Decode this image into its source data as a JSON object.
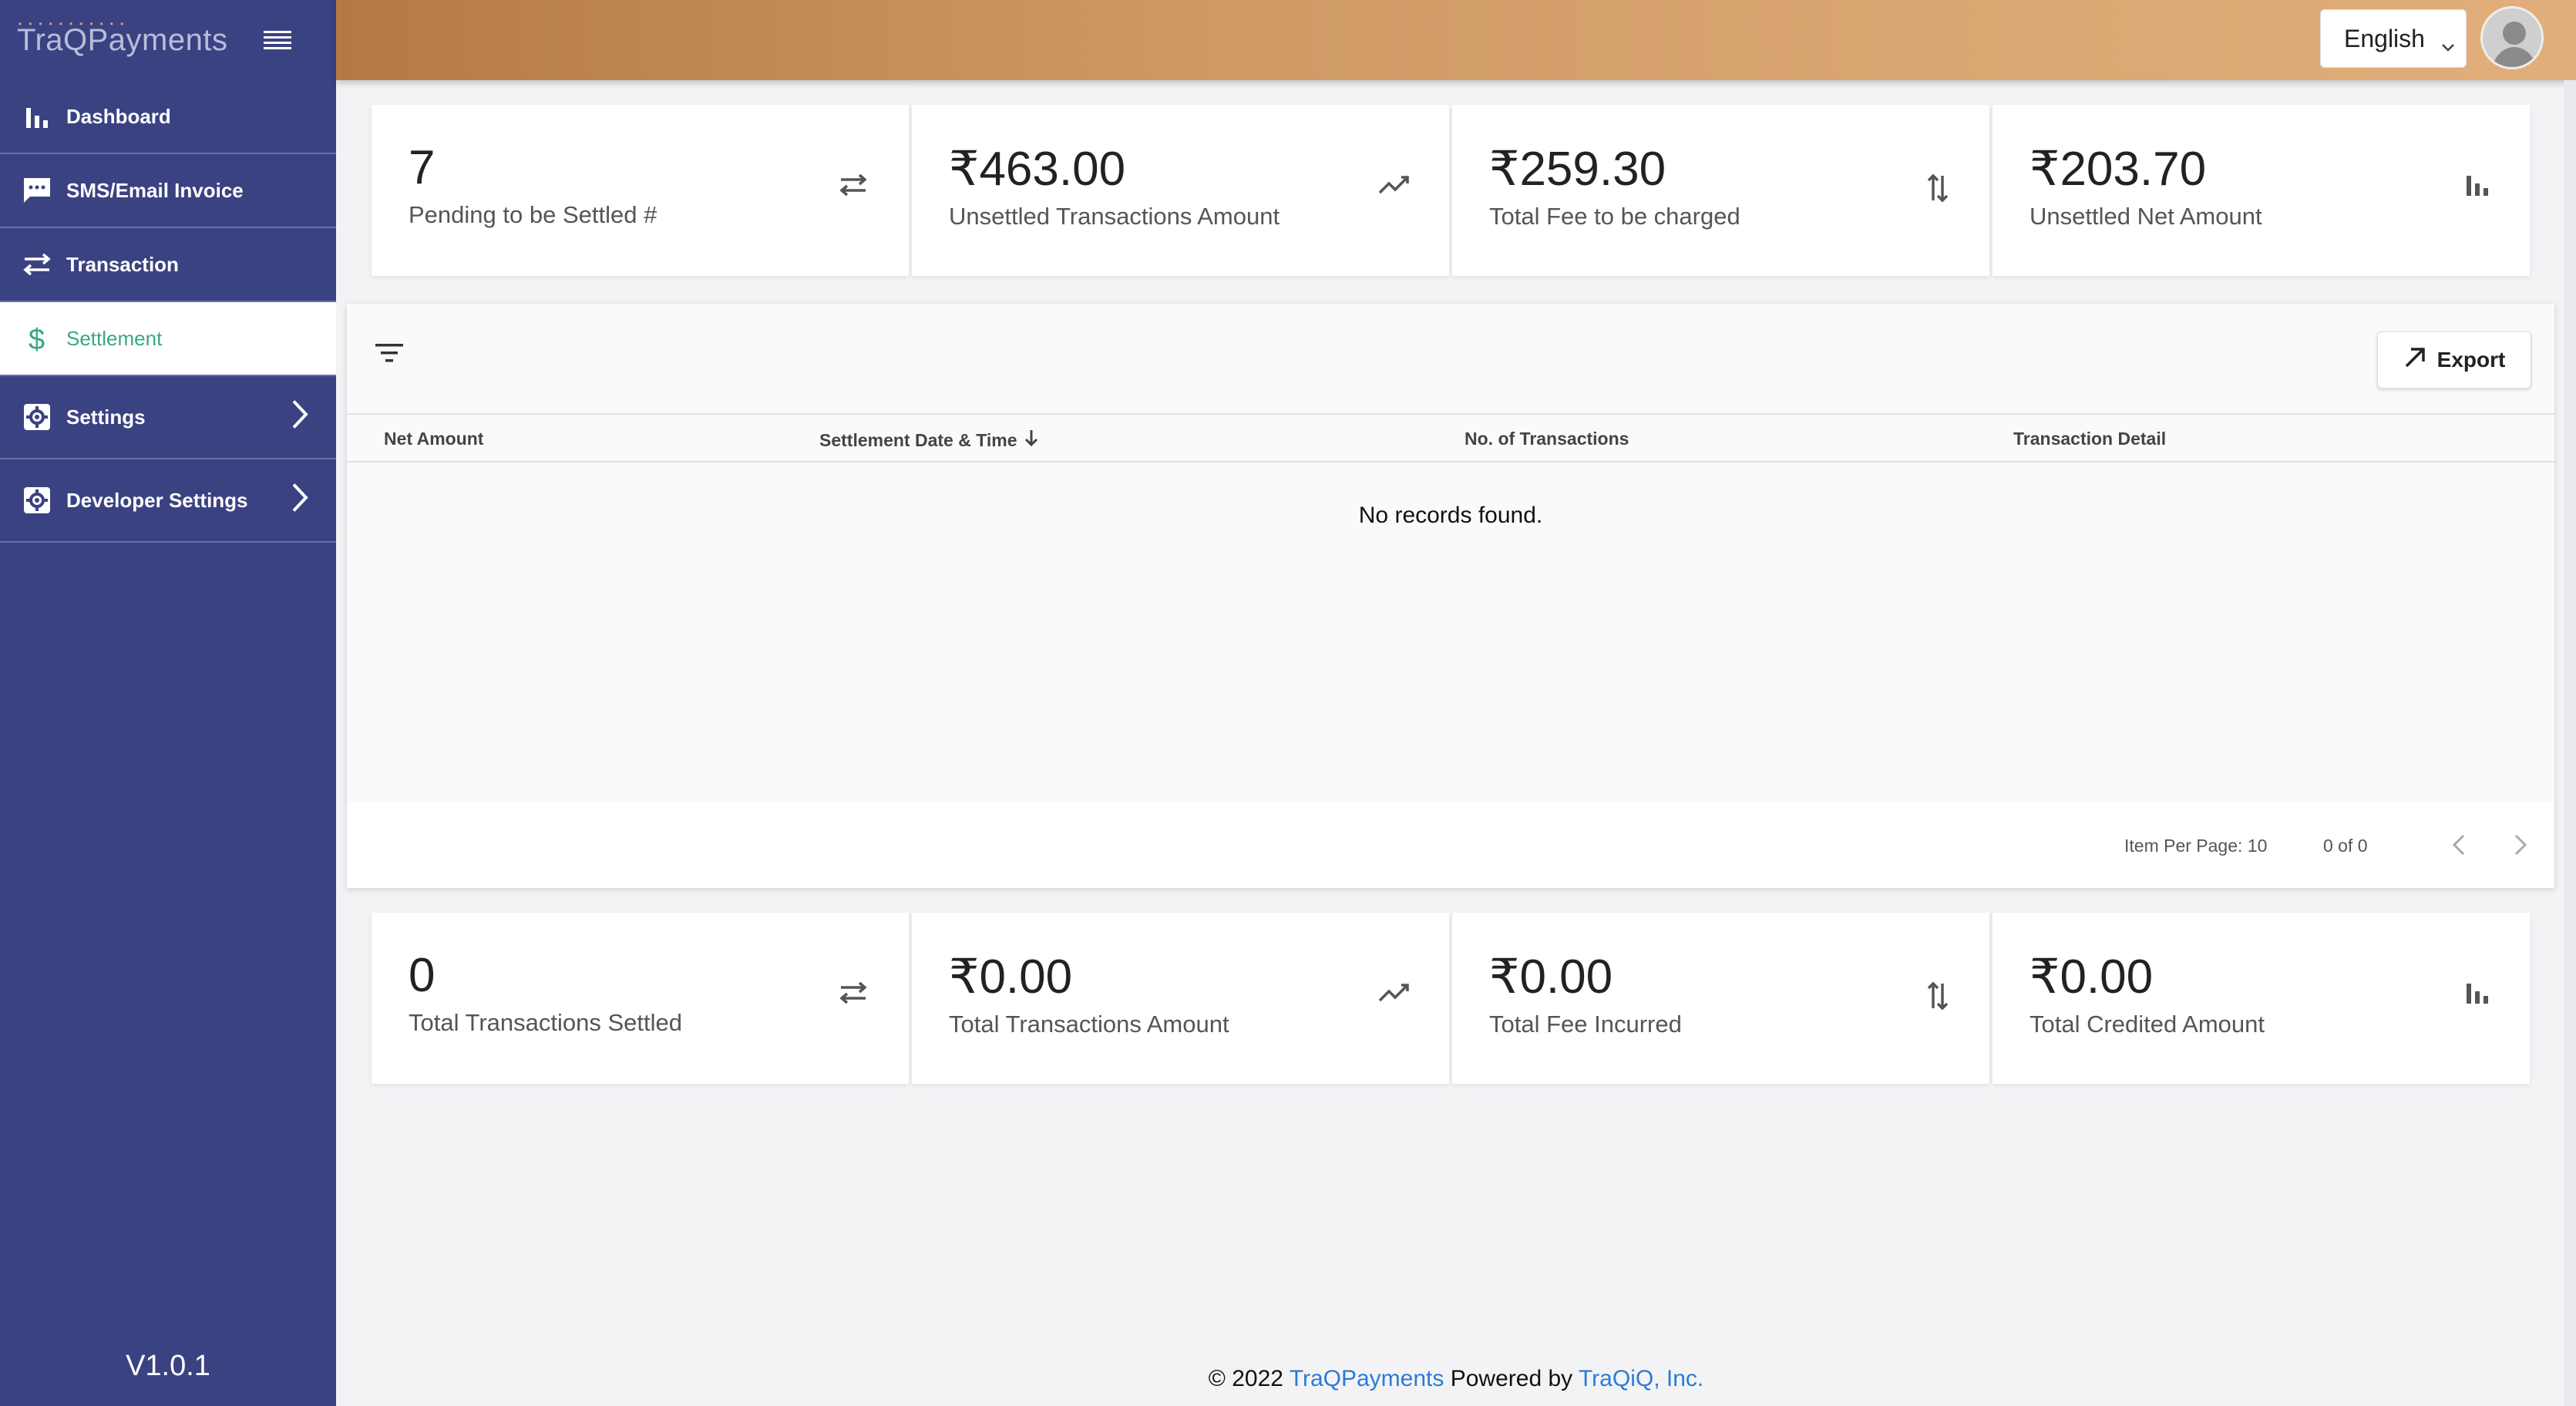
{
  "sidebar": {
    "brand": "TraQPayments",
    "items": [
      {
        "label": "Dashboard",
        "icon": "bar-chart-icon"
      },
      {
        "label": "SMS/Email Invoice",
        "icon": "message-icon"
      },
      {
        "label": "Transaction",
        "icon": "swap-icon"
      },
      {
        "label": "Settlement",
        "icon": "dollar-icon"
      },
      {
        "label": "Settings",
        "icon": "gear-icon"
      },
      {
        "label": "Developer Settings",
        "icon": "gear-icon"
      }
    ],
    "version": "V1.0.1"
  },
  "topbar": {
    "language": "English"
  },
  "top_stats": [
    {
      "value": "7",
      "label": "Pending to be Settled #",
      "icon": "swap-icon"
    },
    {
      "value": "₹463.00",
      "label": "Unsettled Transactions Amount",
      "icon": "trending-icon"
    },
    {
      "value": "₹259.30",
      "label": "Total Fee to be charged",
      "icon": "sort-arrows-icon"
    },
    {
      "value": "₹203.70",
      "label": "Unsettled Net Amount",
      "icon": "bar-chart-icon"
    }
  ],
  "table": {
    "export_label": "Export",
    "columns": [
      "Net Amount",
      "Settlement Date & Time",
      "No. of Transactions",
      "Transaction Detail"
    ],
    "empty_message": "No records found.",
    "items_per_page": "Item Per Page: 10",
    "range": "0 of 0"
  },
  "bottom_stats": [
    {
      "value": "0",
      "label": "Total Transactions Settled",
      "icon": "swap-icon"
    },
    {
      "value": "₹0.00",
      "label": "Total Transactions Amount",
      "icon": "trending-icon"
    },
    {
      "value": "₹0.00",
      "label": "Total Fee Incurred",
      "icon": "sort-arrows-icon"
    },
    {
      "value": "₹0.00",
      "label": "Total Credited Amount",
      "icon": "bar-chart-icon"
    }
  ],
  "footer": {
    "prefix": "© 2022",
    "brand_link": "TraQPayments",
    "middle": "Powered by",
    "company_link": "TraQiQ, Inc."
  },
  "colors": {
    "sidebar": "#3b4282",
    "active_text": "#3aa87d",
    "link": "#2b7bd6"
  }
}
